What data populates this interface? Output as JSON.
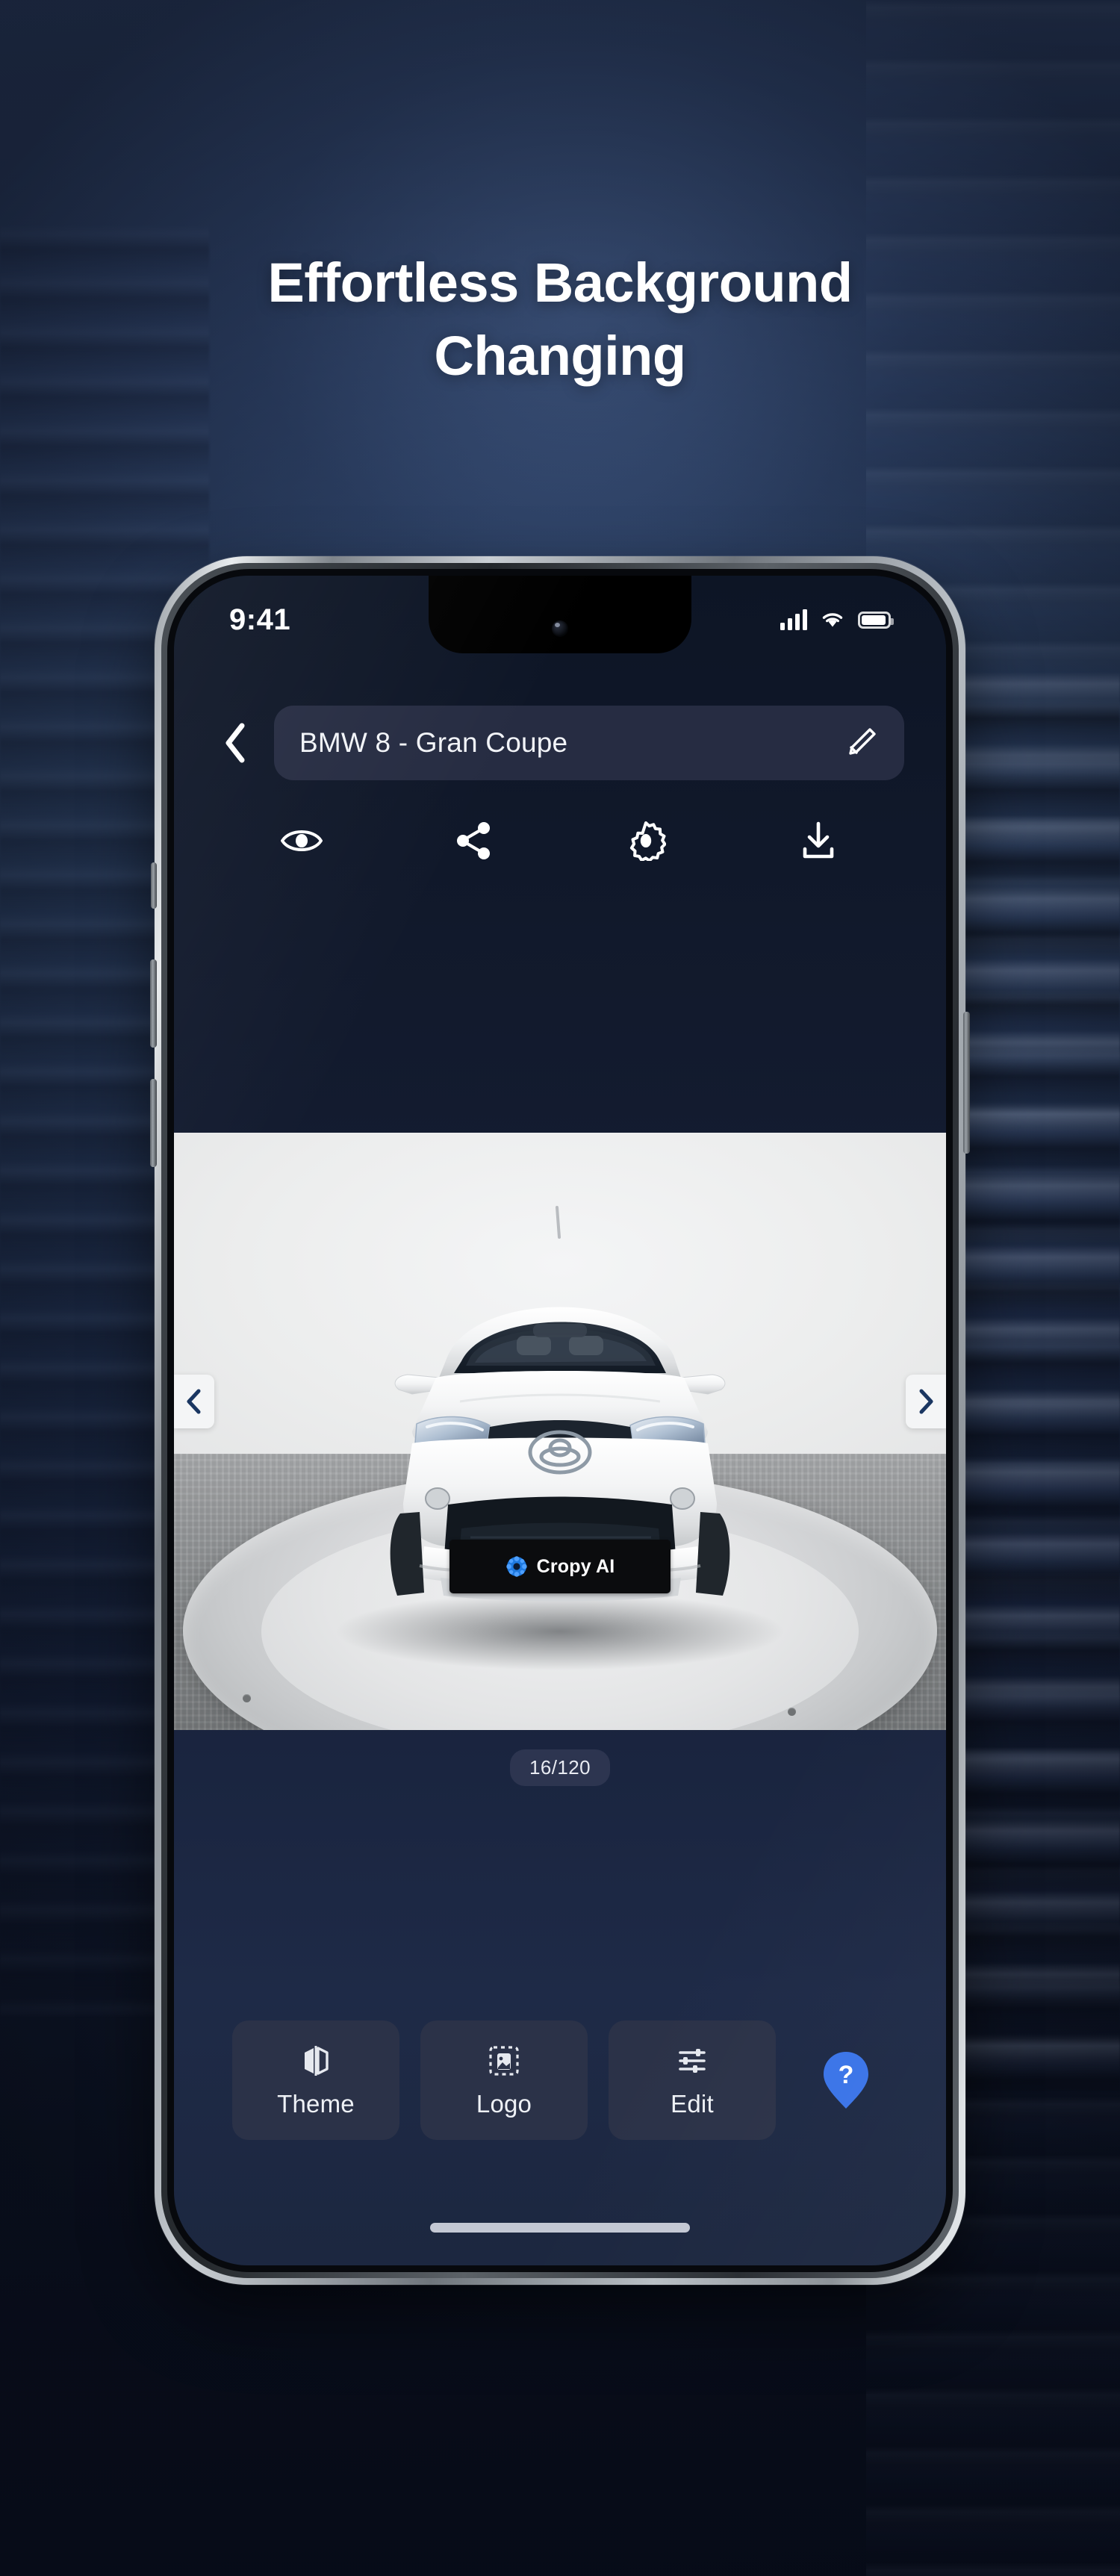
{
  "page": {
    "headline_line1": "Effortless Background",
    "headline_line2": "Changing",
    "background_accent": "#2e4268",
    "screen_background": "#121a2e"
  },
  "phone": {
    "status_bar": {
      "time": "9:41",
      "cellular_icon": "signal-bars-icon",
      "wifi_icon": "wifi-icon",
      "battery_icon": "battery-icon"
    },
    "home_indicator": "home-indicator"
  },
  "app": {
    "title_bar": {
      "back_icon": "chevron-left-icon",
      "project_name": "BMW 8 - Gran Coupe",
      "edit_icon": "pencil-icon"
    },
    "toolbar": [
      {
        "name": "preview",
        "icon": "eye-icon"
      },
      {
        "name": "share",
        "icon": "share-icon"
      },
      {
        "name": "settings",
        "icon": "gear-icon"
      },
      {
        "name": "download",
        "icon": "download-icon"
      }
    ],
    "viewer": {
      "counter": "16/120",
      "prev_icon": "chevron-left-icon",
      "next_icon": "chevron-right-icon",
      "watermark": {
        "text": "Cropy AI",
        "logo_icon": "cropy-ai-logo-icon",
        "logo_color": "#1f7ae0"
      },
      "vehicle": {
        "body_color": "#f4f5f6",
        "brand_emblem": "toyota-emblem-icon",
        "view": "front"
      }
    },
    "bottom_bar": {
      "buttons": [
        {
          "label": "Theme",
          "icon": "theme-icon"
        },
        {
          "label": "Logo",
          "icon": "logo-placeholder-icon"
        },
        {
          "label": "Edit",
          "icon": "sliders-icon"
        }
      ],
      "help": {
        "icon": "help-pin-icon",
        "label": "?",
        "color": "#2f6fe4"
      }
    }
  }
}
